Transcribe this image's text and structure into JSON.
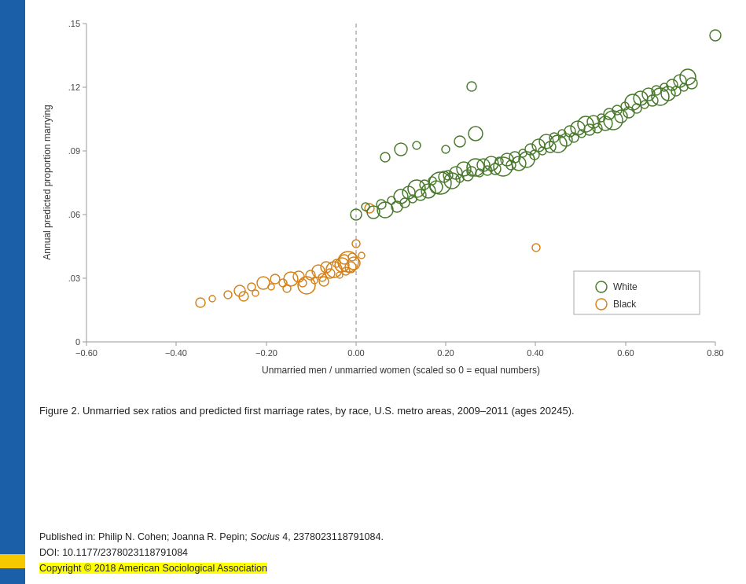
{
  "sidebar": {
    "blue_color": "#1a5fa8",
    "yellow_color": "#f5c800"
  },
  "chart": {
    "title": "Scatter plot: Unmarried sex ratios and predicted first marriage rates by race",
    "x_axis_label": "Unmarried men / unmarried women (scaled so 0 = equal numbers)",
    "y_axis_label": "Annual predicted proportion marrying",
    "x_ticks": [
      "-0.60",
      "-0.40",
      "-0.20",
      "0.00",
      "0.20",
      "0.40",
      "0.60",
      "0.80"
    ],
    "y_ticks": [
      "0",
      ".03",
      ".06",
      ".09",
      ".12",
      ".15"
    ],
    "legend": {
      "white_label": "White",
      "white_color": "#4a7a2e",
      "black_label": "Black",
      "black_color": "#d4821a"
    }
  },
  "figure_caption": "Figure 2. Unmarried sex ratios and predicted first marriage rates, by race, U.S. metro areas, 2009–2011 (ages 20245).",
  "footer": {
    "published_label": "Published in:",
    "authors": "Philip N. Cohen; Joanna R. Pepin;",
    "journal_italic": "Socius",
    "journal_rest": " 4, 2378023118791084.",
    "doi_line": "DOI: 10.1177/2378023118791084",
    "copyright_line": "Copyright © 2018 American Sociological Association"
  }
}
